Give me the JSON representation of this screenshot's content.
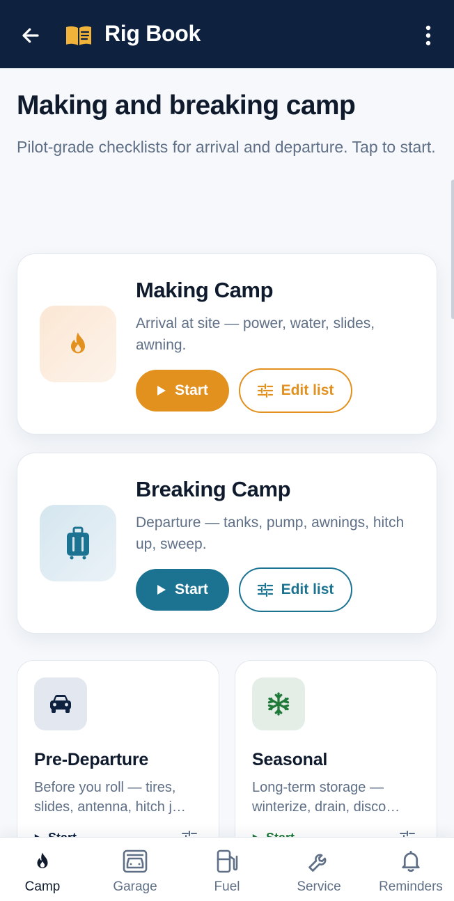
{
  "app_bar": {
    "title": "Rig Book",
    "back_icon": "arrow-left-icon",
    "logo_icon": "open-book-icon",
    "menu_icon": "more-vertical-icon"
  },
  "header": {
    "title": "Making and breaking camp",
    "subtitle": "Pilot-grade checklists for arrival and departure. Tap to start."
  },
  "cards": [
    {
      "title": "Making Camp",
      "description": "Arrival at site — power, water, slides, awning.",
      "icon": "flame-icon",
      "accent": "#e2901e",
      "start_label": "Start",
      "edit_label": "Edit list"
    },
    {
      "title": "Breaking Camp",
      "description": "Departure — tanks, pump, awnings, hitch up, sweep.",
      "icon": "luggage-icon",
      "accent": "#1c7391",
      "start_label": "Start",
      "edit_label": "Edit list"
    }
  ],
  "small_cards": [
    {
      "title": "Pre-Departure",
      "desc_line1": "Before you roll — tires,",
      "desc_line2": "slides, antenna, hitch j…",
      "icon": "car-icon",
      "accent": "#0e2240",
      "start_label": "Start"
    },
    {
      "title": "Seasonal",
      "desc_line1": "Long-term storage —",
      "desc_line2": "winterize, drain, disco…",
      "icon": "snowflake-icon",
      "accent": "#1f7a3a",
      "start_label": "Start"
    }
  ],
  "bottom_nav": {
    "active": "Camp",
    "items": [
      {
        "label": "Camp",
        "icon": "flame-icon"
      },
      {
        "label": "Garage",
        "icon": "garage-icon"
      },
      {
        "label": "Fuel",
        "icon": "fuel-pump-icon"
      },
      {
        "label": "Service",
        "icon": "wrench-icon"
      },
      {
        "label": "Reminders",
        "icon": "bell-icon"
      }
    ]
  }
}
